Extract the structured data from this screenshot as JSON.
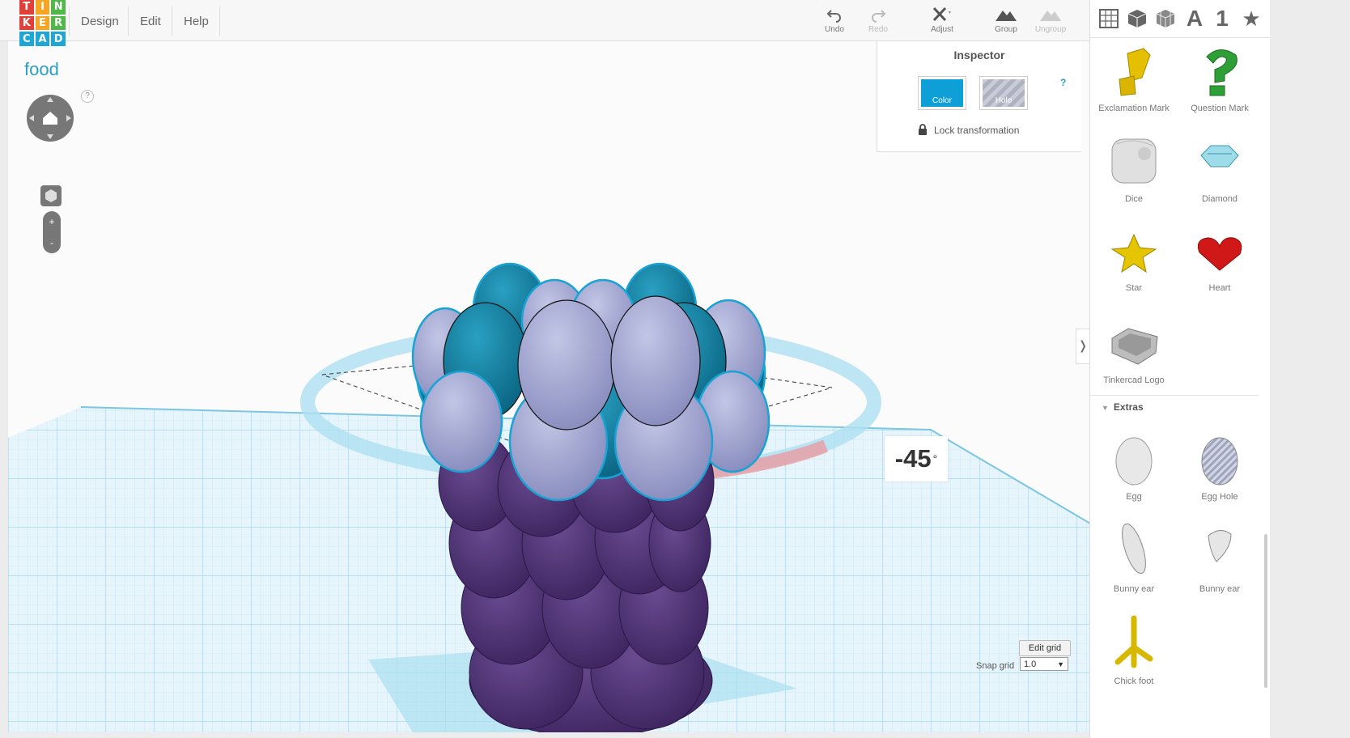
{
  "logo": {
    "letters": [
      "T",
      "I",
      "N",
      "K",
      "E",
      "R",
      "C",
      "A",
      "D"
    ],
    "colors": [
      "#e0403a",
      "#f5a623",
      "#50b848",
      "#e0403a",
      "#f5a623",
      "#50b848",
      "#1ea6d6",
      "#1ea6d6",
      "#1ea6d6"
    ]
  },
  "menu": {
    "design": "Design",
    "edit": "Edit",
    "help": "Help"
  },
  "toolbar": {
    "undo": "Undo",
    "redo": "Redo",
    "adjust": "Adjust",
    "group": "Group",
    "ungroup": "Ungroup"
  },
  "project": {
    "title": "food"
  },
  "viewport": {
    "nav_help": "?",
    "zoom_in": "+",
    "zoom_out": "-",
    "rotation_angle": "-45",
    "degree_symbol": "°"
  },
  "grid": {
    "edit_label": "Edit grid",
    "snap_label": "Snap grid",
    "snap_value": "1.0"
  },
  "inspector": {
    "title": "Inspector",
    "color_label": "Color",
    "hole_label": "Hole",
    "help": "?",
    "lock_label": "Lock transformation",
    "selected_color": "#0e9fd6"
  },
  "panel": {
    "icon_text": "A",
    "icon_number": "1",
    "shapes": [
      {
        "label": "Exclamation Mark"
      },
      {
        "label": "Question Mark"
      },
      {
        "label": "Dice"
      },
      {
        "label": "Diamond"
      },
      {
        "label": "Star"
      },
      {
        "label": "Heart"
      },
      {
        "label": "Tinkercad Logo"
      }
    ],
    "extras_heading": "Extras",
    "extras": [
      {
        "label": "Egg"
      },
      {
        "label": "Egg Hole"
      },
      {
        "label": "Bunny ear"
      },
      {
        "label": "Bunny ear"
      },
      {
        "label": "Chick foot"
      }
    ]
  }
}
